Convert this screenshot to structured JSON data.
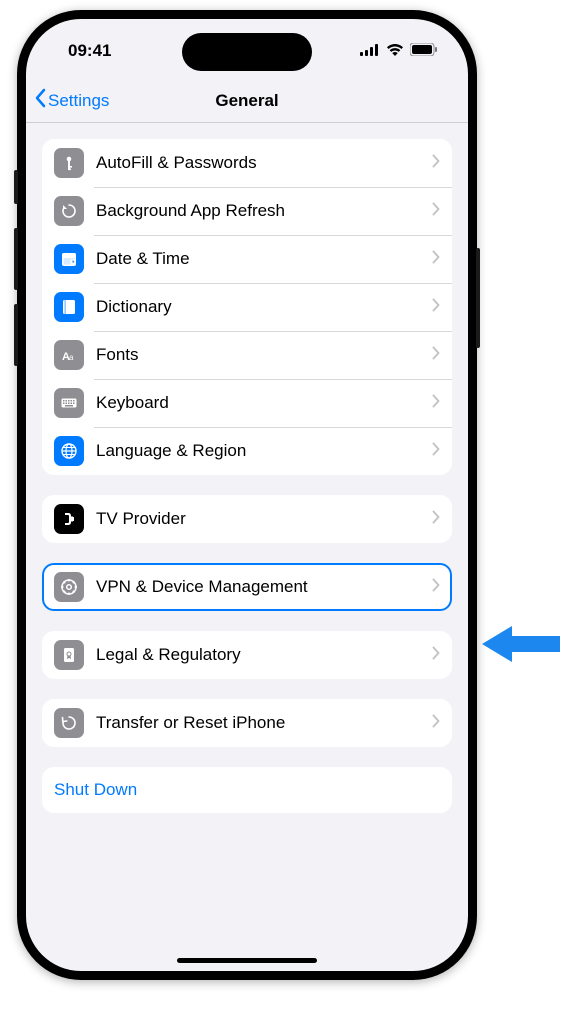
{
  "status": {
    "time": "09:41"
  },
  "nav": {
    "back": "Settings",
    "title": "General"
  },
  "groups": [
    {
      "rows": [
        {
          "id": "autofill",
          "label": "AutoFill & Passwords",
          "iconBg": "#8e8e93",
          "icon": "key"
        },
        {
          "id": "bgrefresh",
          "label": "Background App Refresh",
          "iconBg": "#8e8e93",
          "icon": "refresh"
        },
        {
          "id": "datetime",
          "label": "Date & Time",
          "iconBg": "#007aff",
          "icon": "calendar"
        },
        {
          "id": "dictionary",
          "label": "Dictionary",
          "iconBg": "#007aff",
          "icon": "book"
        },
        {
          "id": "fonts",
          "label": "Fonts",
          "iconBg": "#8e8e93",
          "icon": "fonts"
        },
        {
          "id": "keyboard",
          "label": "Keyboard",
          "iconBg": "#8e8e93",
          "icon": "keyboard"
        },
        {
          "id": "language",
          "label": "Language & Region",
          "iconBg": "#007aff",
          "icon": "globe"
        }
      ]
    },
    {
      "rows": [
        {
          "id": "tvprovider",
          "label": "TV Provider",
          "iconBg": "#000000",
          "icon": "tv"
        }
      ]
    },
    {
      "rows": [
        {
          "id": "vpn",
          "label": "VPN & Device Management",
          "iconBg": "#8e8e93",
          "icon": "gear",
          "highlighted": true
        }
      ]
    },
    {
      "rows": [
        {
          "id": "legal",
          "label": "Legal & Regulatory",
          "iconBg": "#8e8e93",
          "icon": "cert"
        }
      ]
    },
    {
      "rows": [
        {
          "id": "transfer",
          "label": "Transfer or Reset iPhone",
          "iconBg": "#8e8e93",
          "icon": "reset"
        }
      ]
    },
    {
      "plain": true,
      "rows": [
        {
          "id": "shutdown",
          "label": "Shut Down"
        }
      ]
    }
  ]
}
